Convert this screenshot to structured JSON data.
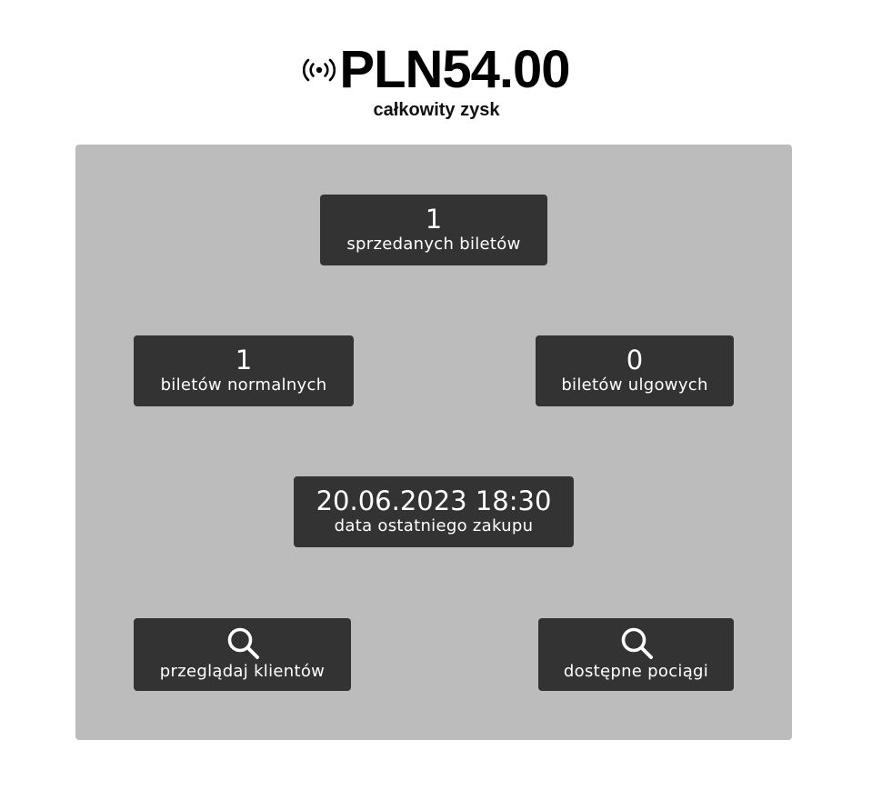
{
  "header": {
    "total_value": "PLN54.00",
    "total_label": "całkowity zysk"
  },
  "stats": {
    "tickets_sold": {
      "value": "1",
      "label": "sprzedanych biletów"
    },
    "normal_tickets": {
      "value": "1",
      "label": "biletów normalnych"
    },
    "reduced_tickets": {
      "value": "0",
      "label": "biletów ulgowych"
    },
    "last_purchase": {
      "value": "20.06.2023 18:30",
      "label": "data ostatniego zakupu"
    }
  },
  "actions": {
    "browse_clients": {
      "label": "przeglądaj klientów",
      "icon": "search-icon"
    },
    "available_trains": {
      "label": "dostępne pociągi",
      "icon": "search-icon"
    }
  },
  "colors": {
    "panel_bg": "#bcbcbc",
    "tile_bg": "#333333",
    "tile_text": "#ffffff"
  }
}
